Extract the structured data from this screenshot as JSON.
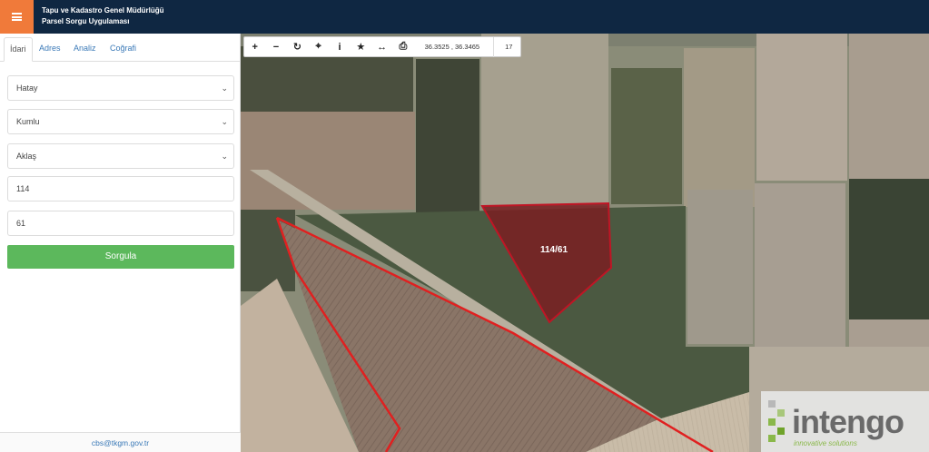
{
  "header": {
    "title_line1": "Tapu ve Kadastro Genel Müdürlüğü",
    "title_line2": "Parsel Sorgu Uygulaması",
    "menu_icon": "hamburger-icon"
  },
  "sidebar": {
    "tabs": [
      {
        "label": "İdari",
        "active": true
      },
      {
        "label": "Adres",
        "active": false
      },
      {
        "label": "Analiz",
        "active": false
      },
      {
        "label": "Coğrafi",
        "active": false
      }
    ],
    "il": "Hatay",
    "ilce": "Kumlu",
    "mahalle": "Aklaş",
    "ada": "114",
    "parsel": "61",
    "search_button": "Sorgula",
    "footer_email": "cbs@tkgm.gov.tr"
  },
  "toolbar": {
    "buttons": [
      "plus-icon",
      "minus-icon",
      "refresh-icon",
      "crosshair-icon",
      "info-icon",
      "star-icon",
      "measure-icon",
      "print-icon"
    ],
    "coordinates": "36.3525 , 36.3465",
    "zoom_level": "17"
  },
  "map": {
    "parcel_label": "114/61",
    "parcel_fill": "#7a1e22",
    "boundary_color": "#e02020"
  },
  "logo": {
    "name": "intengo",
    "tagline": "innovative solutions"
  }
}
